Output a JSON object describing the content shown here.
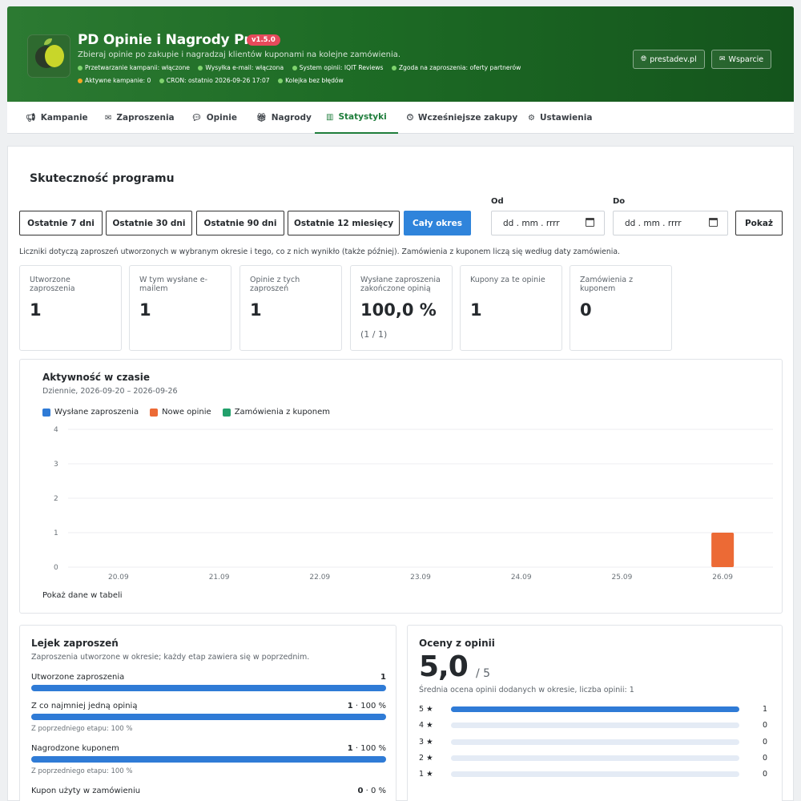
{
  "header": {
    "title": "PD Opinie i Nagrody Pro",
    "version": "v1.5.0",
    "subtitle": "Zbieraj opinie po zakupie i nagradzaj klientów kuponami na kolejne zamówienia.",
    "status_line1": [
      "Przetwarzanie kampanii: włączone",
      "Wysyłka e-mail: włączona",
      "System opinii: IQIT Reviews",
      "Zgoda na zaproszenia: oferty partnerów"
    ],
    "status_line2": [
      "Aktywne kampanie: 0",
      "CRON: ostatnio 2026-09-26 17:07",
      "Kolejka bez błędów"
    ],
    "site_button": "prestadev.pl",
    "support_button": "Wsparcie"
  },
  "tabs": [
    "Kampanie",
    "Zaproszenia",
    "Opinie",
    "Nagrody",
    "Statystyki",
    "Wcześniejsze zakupy",
    "Ustawienia"
  ],
  "section_title": "Skuteczność programu",
  "period_buttons": [
    "Ostatnie 7 dni",
    "Ostatnie 30 dni",
    "Ostatnie 90 dni",
    "Ostatnie 12 miesięcy",
    "Cały okres"
  ],
  "date_from": {
    "label": "Od",
    "placeholder": "dd . mm . rrrr"
  },
  "date_to": {
    "label": "Do",
    "placeholder": "dd . mm . rrrr"
  },
  "show_button": "Pokaż",
  "note": "Liczniki dotyczą zaproszeń utworzonych w wybranym okresie i tego, co z nich wynikło (także później). Zamówienia z kuponem liczą się według daty zamówienia.",
  "cards": [
    {
      "label": "Utworzone zaproszenia",
      "value": "1",
      "sub": ""
    },
    {
      "label": "W tym wysłane e-mailem",
      "value": "1",
      "sub": ""
    },
    {
      "label": "Opinie z tych zaproszeń",
      "value": "1",
      "sub": ""
    },
    {
      "label": "Wysłane zaproszenia zakończone opinią",
      "value": "100,0 %",
      "sub": "(1 / 1)"
    },
    {
      "label": "Kupony za te opinie",
      "value": "1",
      "sub": ""
    },
    {
      "label": "Zamówienia z kuponem",
      "value": "0",
      "sub": ""
    }
  ],
  "activity": {
    "title": "Aktywność w czasie",
    "subtitle": "Dziennie, 2026-09-20 – 2026-09-26",
    "table_link": "Pokaż dane w tabeli"
  },
  "chart_data": {
    "type": "bar",
    "categories": [
      "20.09",
      "21.09",
      "22.09",
      "23.09",
      "24.09",
      "25.09",
      "26.09"
    ],
    "series": [
      {
        "name": "Wysłane zaproszenia",
        "color": "#2f7bd6",
        "values": [
          0,
          0,
          0,
          0,
          0,
          0,
          0
        ]
      },
      {
        "name": "Nowe opinie",
        "color": "#ec6a35",
        "values": [
          0,
          0,
          0,
          0,
          0,
          0,
          1
        ]
      },
      {
        "name": "Zamówienia z kuponem",
        "color": "#22a06b",
        "values": [
          0,
          0,
          0,
          0,
          0,
          0,
          0
        ]
      }
    ],
    "yticks": [
      0,
      1,
      2,
      3,
      4
    ],
    "ylim": [
      0,
      4
    ],
    "grid": true,
    "legend": "top-left"
  },
  "funnel": {
    "title": "Lejek zaproszeń",
    "subtitle": "Zaproszenia utworzone w okresie; każdy etap zawiera się w poprzednim.",
    "rows": [
      {
        "label": "Utworzone zaproszenia",
        "value": "1",
        "pct": "",
        "fraction": 1,
        "prev": ""
      },
      {
        "label": "Z co najmniej jedną opinią",
        "value": "1",
        "pct": " · 100 %",
        "fraction": 1,
        "prev": "Z poprzedniego etapu: 100 %"
      },
      {
        "label": "Nagrodzone kuponem",
        "value": "1",
        "pct": " · 100 %",
        "fraction": 1,
        "prev": "Z poprzedniego etapu: 100 %"
      },
      {
        "label": "Kupon użyty w zamówieniu",
        "value": "0",
        "pct": " · 0 %",
        "fraction": 0,
        "prev": ""
      }
    ]
  },
  "ratings": {
    "title": "Oceny z opinii",
    "average": "5,0",
    "of": "/ 5",
    "subtitle": "Średnia ocena opinii dodanych w okresie, liczba opinii: 1",
    "rows": [
      {
        "label": "5 ★",
        "count": "1",
        "fraction": 1
      },
      {
        "label": "4 ★",
        "count": "0",
        "fraction": 0
      },
      {
        "label": "3 ★",
        "count": "0",
        "fraction": 0
      },
      {
        "label": "2 ★",
        "count": "0",
        "fraction": 0
      },
      {
        "label": "1 ★",
        "count": "0",
        "fraction": 0
      }
    ]
  },
  "colors": {
    "accent": "#1e7d3b",
    "primary": "#2f84db",
    "badge": "#e64a5b"
  },
  "icons": {
    "site": "globe-icon",
    "support": "envelope-icon",
    "tabs": [
      "megaphone-icon",
      "envelope-icon",
      "chat-icon",
      "gift-icon",
      "chart-icon",
      "clock-icon",
      "gears-icon"
    ]
  }
}
